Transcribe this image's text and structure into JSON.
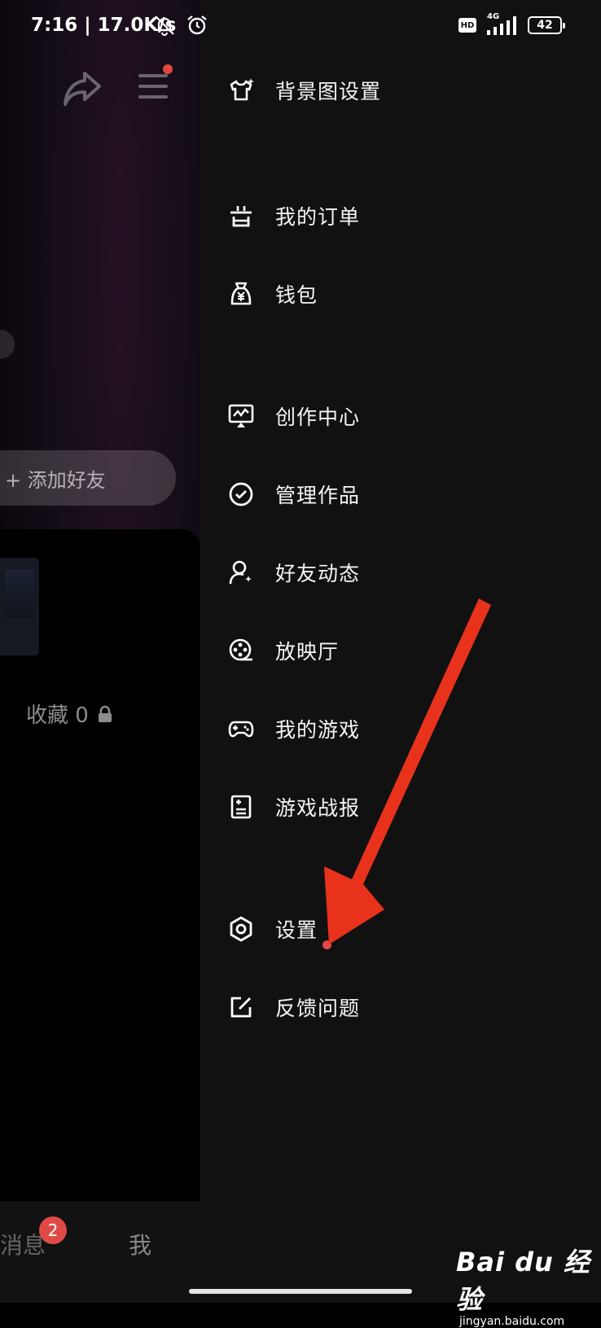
{
  "status_bar": {
    "time": "7:16 | 17.0K/s",
    "hd": "HD",
    "network": "4G",
    "battery": "42"
  },
  "left_panel": {
    "add_friend": "+ 添加好友",
    "collect_label": "收藏 0",
    "tab_message": "消息",
    "tab_message_badge": "2",
    "tab_me": "我"
  },
  "drawer": {
    "items": [
      {
        "label": "背景图设置",
        "icon": "shirt-icon"
      },
      {
        "label": "我的订单",
        "icon": "order-icon"
      },
      {
        "label": "钱包",
        "icon": "wallet-icon"
      },
      {
        "label": "创作中心",
        "icon": "creator-icon"
      },
      {
        "label": "管理作品",
        "icon": "check-circle-icon"
      },
      {
        "label": "好友动态",
        "icon": "friend-icon"
      },
      {
        "label": "放映厅",
        "icon": "film-reel-icon"
      },
      {
        "label": "我的游戏",
        "icon": "gamepad-icon"
      },
      {
        "label": "游戏战报",
        "icon": "report-icon"
      },
      {
        "label": "设置",
        "icon": "hexagon-settings-icon"
      },
      {
        "label": "反馈问题",
        "icon": "edit-icon"
      }
    ]
  },
  "watermark": {
    "logo": "Bai du 经验",
    "url": "jingyan.baidu.com"
  },
  "colors": {
    "drawer_bg": "#111111",
    "arrow": "#e8321c",
    "badge": "#e04a46"
  }
}
